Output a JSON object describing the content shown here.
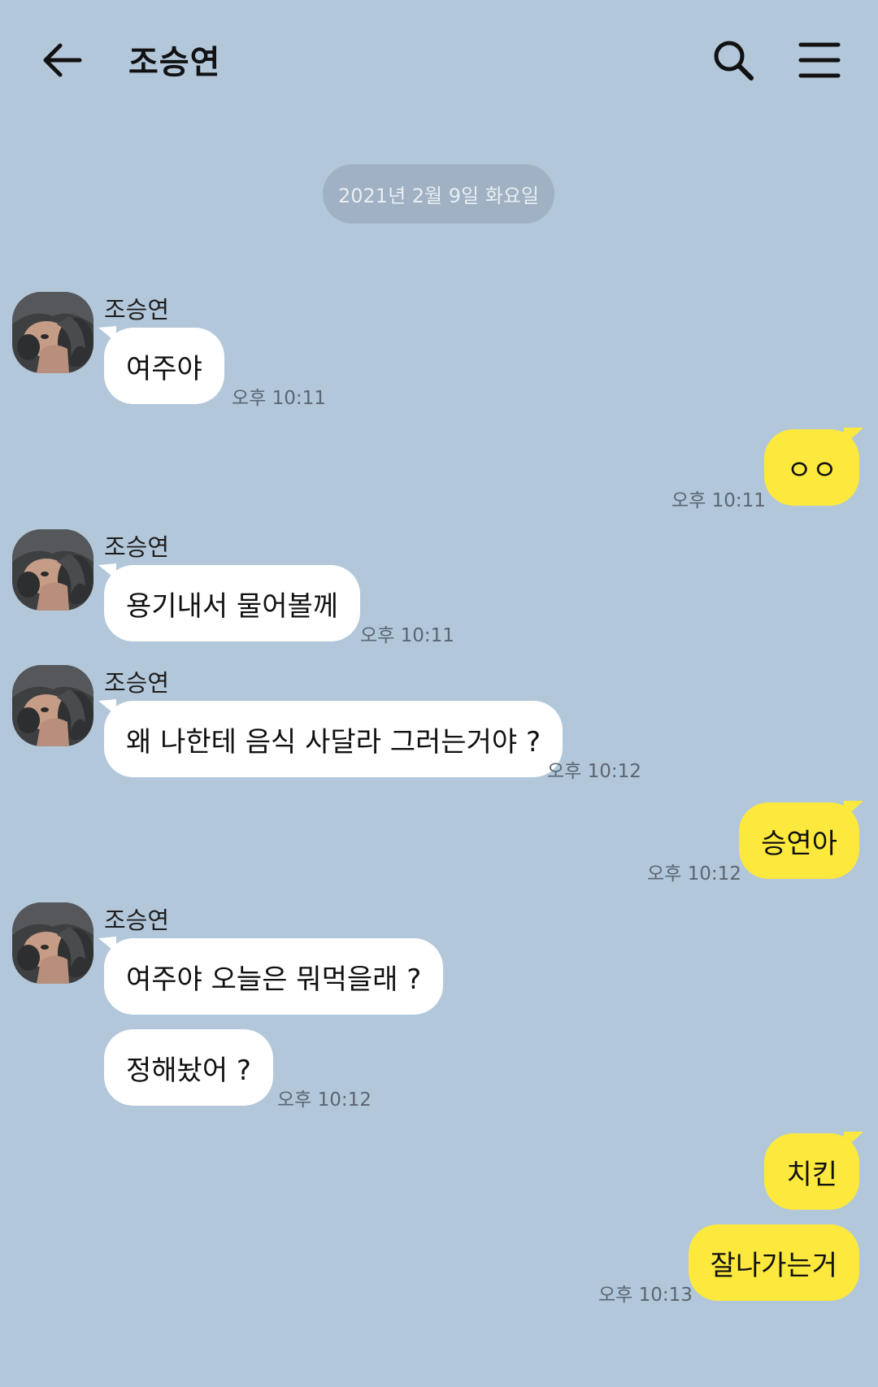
{
  "header": {
    "title": "조승연"
  },
  "date_divider": "2021년 2월 9일 화요일",
  "colors": {
    "background": "#b2c7da",
    "incoming_bubble": "#ffffff",
    "outgoing_bubble": "#fde93d",
    "date_pill": "#9fb1c2"
  },
  "icons": [
    "back-arrow-icon",
    "search-icon",
    "menu-icon"
  ],
  "messages": [
    {
      "direction": "in",
      "sender": "조승연",
      "text": "여주야",
      "time": "오후 10:11"
    },
    {
      "direction": "out",
      "text": "ㅇㅇ",
      "time": "오후 10:11"
    },
    {
      "direction": "in",
      "sender": "조승연",
      "text": "용기내서 물어볼께",
      "time": "오후 10:11"
    },
    {
      "direction": "in",
      "sender": "조승연",
      "text": "왜 나한테 음식 사달라 그러는거야 ?",
      "time": "오후 10:12"
    },
    {
      "direction": "out",
      "text": "승연아",
      "time": "오후 10:12"
    },
    {
      "direction": "in",
      "sender": "조승연",
      "text": "여주야 오늘은 뭐먹을래 ?"
    },
    {
      "direction": "in",
      "text": "정해놨어 ?",
      "time": "오후 10:12"
    },
    {
      "direction": "out",
      "text": "치킨"
    },
    {
      "direction": "out",
      "text": "잘나가는거",
      "time": "오후 10:13"
    }
  ]
}
